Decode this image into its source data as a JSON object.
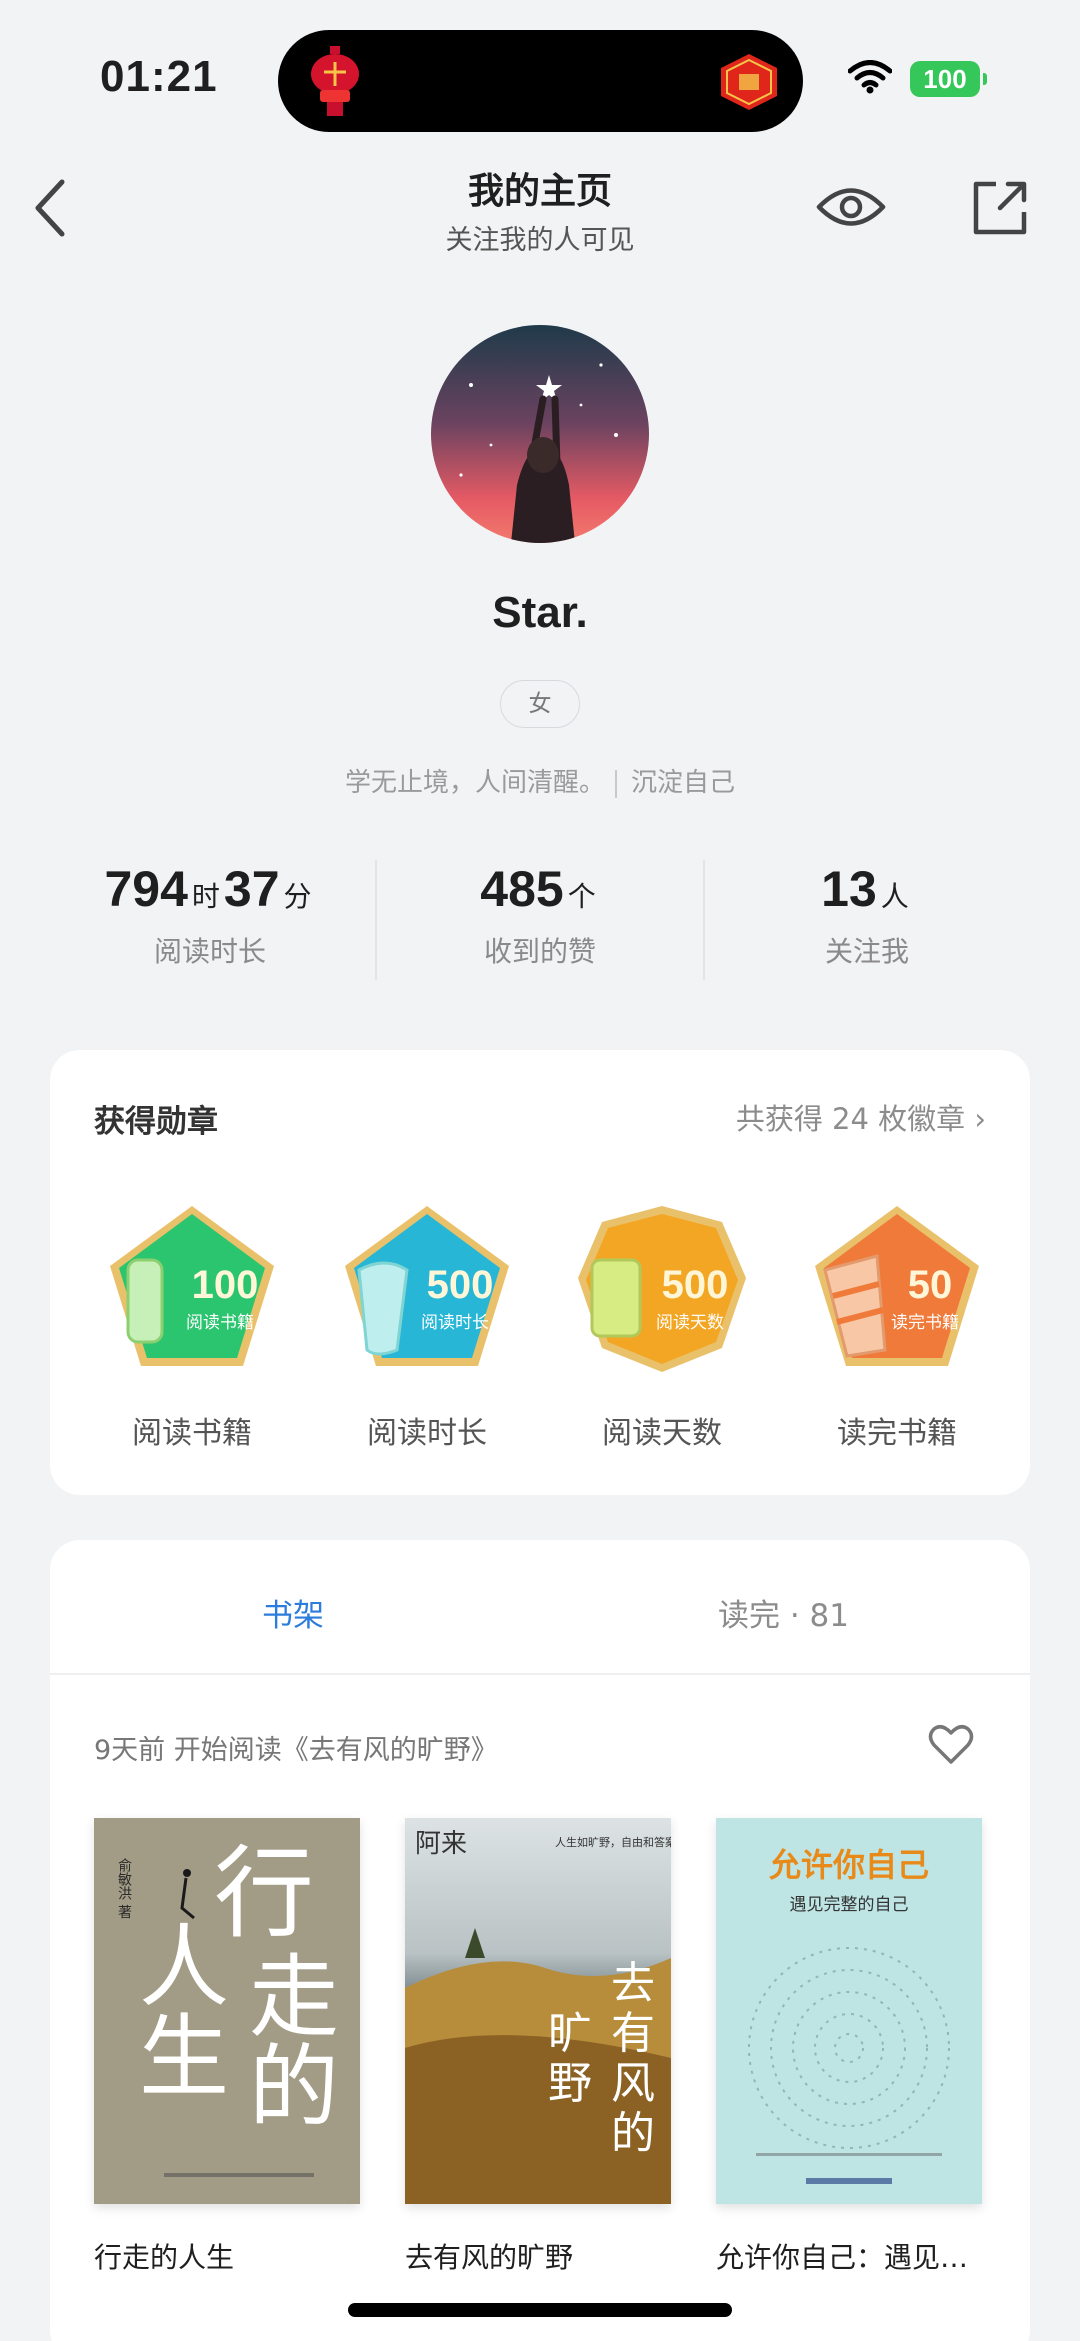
{
  "status_bar": {
    "time": "01:21",
    "battery": "100"
  },
  "header": {
    "title": "我的主页",
    "subtitle": "关注我的人可见"
  },
  "profile": {
    "name": "Star.",
    "gender": "女",
    "bio": "学无止境，人间清醒。",
    "bio_tag": "沉淀自己"
  },
  "stats": {
    "reading_time": {
      "hours": "794",
      "hours_unit": "时",
      "minutes": "37",
      "minutes_unit": "分",
      "label": "阅读时长"
    },
    "likes": {
      "value": "485",
      "unit": "个",
      "label": "收到的赞"
    },
    "followers": {
      "value": "13",
      "unit": "人",
      "label": "关注我"
    }
  },
  "medals": {
    "title": "获得勋章",
    "more": "共获得 24 枚徽章",
    "items": [
      {
        "number": "100",
        "caption": "阅读书籍",
        "label": "阅读书籍",
        "color": "#2BC46F"
      },
      {
        "number": "500",
        "caption": "阅读时长",
        "label": "阅读时长",
        "color": "#27B6D6"
      },
      {
        "number": "500",
        "caption": "阅读天数",
        "label": "阅读天数",
        "color": "#F3A623"
      },
      {
        "number": "50",
        "caption": "读完书籍",
        "label": "读完书籍",
        "color": "#F07A3A"
      }
    ]
  },
  "shelf": {
    "tabs": [
      {
        "label": "书架"
      },
      {
        "label": "读完 · 81"
      }
    ],
    "recent": "9天前 开始阅读《去有风的旷野》",
    "books": [
      {
        "title": "行走的人生",
        "cover_author": "俞敏洪 著",
        "cover_text": "行走的人生"
      },
      {
        "title": "去有风的旷野",
        "cover_author": "阿来",
        "cover_text": "去有风的旷野",
        "cover_quote": "人生如旷野，自由和答案都在风里。"
      },
      {
        "title": "允许你自己：遇见…",
        "cover_title": "允许你自己",
        "cover_subtitle": "遇见完整的自己"
      }
    ]
  },
  "colors": {
    "accent": "#2C7DDB",
    "background": "#F2F3F5"
  }
}
